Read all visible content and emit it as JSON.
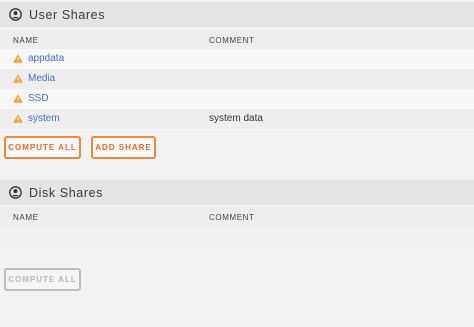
{
  "user_shares": {
    "title": "User Shares",
    "columns": {
      "name": "NAME",
      "comment": "COMMENT"
    },
    "rows": [
      {
        "name": "appdata",
        "comment": ""
      },
      {
        "name": "Media",
        "comment": ""
      },
      {
        "name": "SSD",
        "comment": ""
      },
      {
        "name": "system",
        "comment": "system data"
      }
    ],
    "compute_all_label": "COMPUTE ALL",
    "add_share_label": "ADD SHARE"
  },
  "disk_shares": {
    "title": "Disk Shares",
    "columns": {
      "name": "NAME",
      "comment": "COMMENT"
    },
    "compute_all_label": "COMPUTE ALL"
  },
  "colors": {
    "accent": "#e8883f",
    "link": "#486dba",
    "warning": "#f0a030"
  }
}
